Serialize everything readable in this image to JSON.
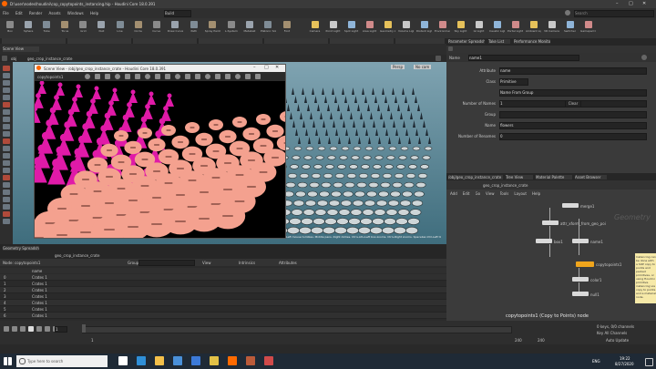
{
  "window": {
    "title": "D:\\user\\nodes\\houdini\\cop_copytopoints_instancing.hip - Houdini Core 18.0.391",
    "search_placeholder": "Search"
  },
  "menu": [
    "File",
    "Edit",
    "Render",
    "Assets",
    "Windows",
    "Help"
  ],
  "desktop_label": "Build",
  "shelf": {
    "left_tools": [
      "Box",
      "Sphere",
      "Tube",
      "Torus",
      "Grid",
      "Null",
      "Line",
      "Circle",
      "Curve",
      "Draw Curve",
      "Path",
      "Spray Paint",
      "L-System",
      "Metaball",
      "Platonic Solids",
      "Font"
    ],
    "right_tools": [
      "Camera",
      "Point Light",
      "Spot Light",
      "Area Light",
      "Geometry Light",
      "Volume Light",
      "Distant Light",
      "Environment Light",
      "Sky Light",
      "GI Light",
      "Caustic Light",
      "Portal Light",
      "Ambient Light",
      "VR Camera",
      "Switcher",
      "Gamepad Camera"
    ]
  },
  "scene_view": {
    "path": "obj",
    "node": "geo_crop_instance_crate",
    "tab": "Scene View",
    "persp_label": "Persp",
    "cam_label": "No cam"
  },
  "float_window": {
    "title": "Scene View - /obj/geo_crop_instance_crate - Houdini Core 18.0.391",
    "path_label": "copytopoints1"
  },
  "status_hint": "Left mouse tumbles. Middle pans. Right dollies. Ctrl+Alt+Left box-zooms. Ctrl+Right zooms. Spacebar-Ctrl-Left tilts. Hold L for alternate tumble, dolly, and zoom.",
  "params": {
    "tabs": [
      "Parameter Spreadsheet",
      "Take List",
      "Performance Monitor"
    ],
    "node_type": "Name",
    "node_name": "name1",
    "fields": [
      {
        "label": "Attribute",
        "value": "name"
      },
      {
        "label": "Class",
        "value": "Primitive"
      },
      {
        "label": "",
        "value": "Name From Group"
      },
      {
        "label": "Number of Names",
        "value": "1"
      },
      {
        "label": "Group",
        "value": ""
      },
      {
        "label": "Name",
        "value": "flowers"
      },
      {
        "label": "Number of Renames",
        "value": "0"
      }
    ],
    "clear_label": "Clear"
  },
  "network": {
    "tabs": [
      "/obj/geo_crop_instance_crate",
      "Tree View",
      "Material Palette",
      "Asset Browser"
    ],
    "menu": [
      "Add",
      "Edit",
      "Go",
      "View",
      "Tools",
      "Layout",
      "Help"
    ],
    "path": "geo_crop_instance_crate",
    "context_label": "Geometry",
    "nodes": [
      {
        "label": "merge1"
      },
      {
        "label": "attr_xform_from_geo_points"
      },
      {
        "label": "box1"
      },
      {
        "label": "name1"
      },
      {
        "label": "copytopoints1"
      },
      {
        "label": "color1"
      },
      {
        "label": "null1"
      }
    ],
    "note": "Instancing can be done with a SOP copy to points and packed primitives, or using Houdini primitive instancing via copy to points and a material node.",
    "tooltip": "copytopoints1 (Copy to Points) node"
  },
  "spreadsheet": {
    "tab": "Geometry Spreadsheet",
    "node": "geo_crop_instance_crate",
    "labels": [
      "Node:",
      "copytopoints1",
      "Group:",
      "View",
      "Intrinsics",
      "Attributes"
    ],
    "column": "name",
    "rows": [
      {
        "idx": "0",
        "name": "Crates 1"
      },
      {
        "idx": "1",
        "name": "Crates 1"
      },
      {
        "idx": "2",
        "name": "Crates 1"
      },
      {
        "idx": "3",
        "name": "Crates 1"
      },
      {
        "idx": "4",
        "name": "Crates 1"
      },
      {
        "idx": "5",
        "name": "Crates 1"
      },
      {
        "idx": "6",
        "name": "Crates 1"
      }
    ]
  },
  "timeline": {
    "frame": "1",
    "start": "1",
    "end": "240",
    "range_end": "240",
    "keys_label": "0 keys, 0/0 channels",
    "key_all_label": "Key All Channels",
    "auto_update": "Auto Update"
  },
  "taskbar": {
    "search": "Type here to search",
    "language": "ENG",
    "time": "19:22",
    "date": "8/27/2020"
  },
  "colors": {
    "magenta": "#e01aa8",
    "salmon": "#f4a18f",
    "selected_node": "#f0a51c",
    "taskbar": "#1f2a36"
  }
}
